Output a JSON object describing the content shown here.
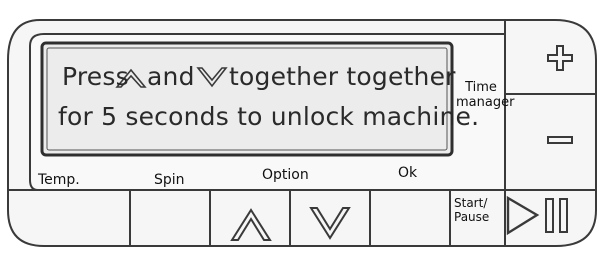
{
  "display": {
    "line1_start": "Press",
    "line1_mid": "and",
    "line1_end": "together together",
    "line2": "for 5 seconds to unlock machine.",
    "up_icon": "up-chevron-outline-icon",
    "down_icon": "down-chevron-outline-icon"
  },
  "time_manager": {
    "line1": "Time",
    "line2": "manager"
  },
  "labels": {
    "temp": "Temp.",
    "spin": "Spin",
    "option": "Option",
    "ok": "Ok"
  },
  "start_pause": {
    "line1": "Start/",
    "line2": "Pause",
    "play_icon": "play-triangle-icon",
    "pause_icon": "pause-bars-icon"
  },
  "side_buttons": {
    "plus_icon": "plus-icon",
    "minus_icon": "minus-icon"
  },
  "colors": {
    "outline": "#3a3a3a",
    "lcd_fill": "#e9e9e9",
    "panel_fill": "#f4f4f4",
    "text": "#222222"
  }
}
